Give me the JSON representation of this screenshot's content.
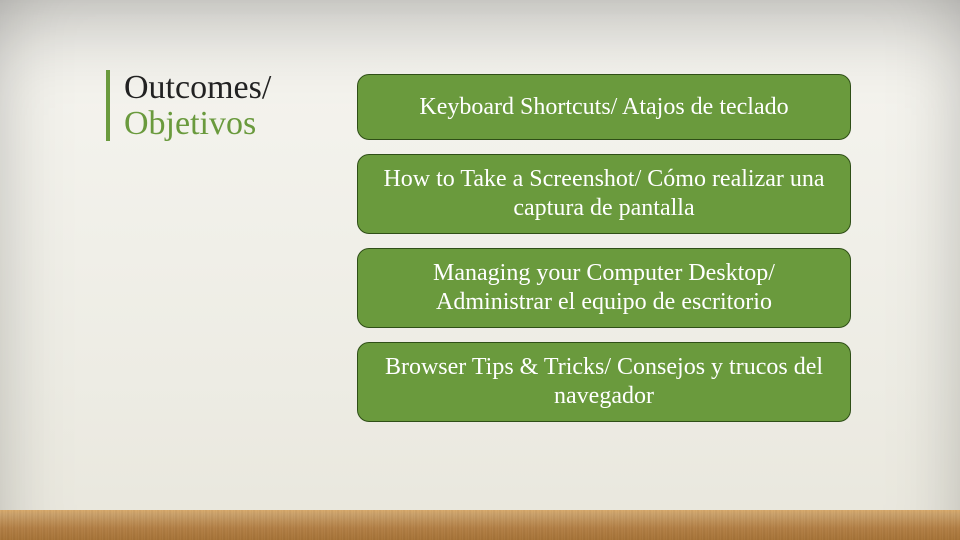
{
  "title": {
    "line1": "Outcomes/",
    "line2": "Objetivos"
  },
  "items": [
    "Keyboard Shortcuts/ Atajos de teclado",
    "How to Take a Screenshot/ Cómo realizar una captura de pantalla",
    "Managing your Computer Desktop/ Administrar el equipo de escritorio",
    "Browser Tips & Tricks/ Consejos y trucos del navegador"
  ],
  "colors": {
    "accent": "#6a9a3d",
    "title_text": "#222222",
    "item_text": "#ffffff",
    "wood": "#b37f44"
  }
}
